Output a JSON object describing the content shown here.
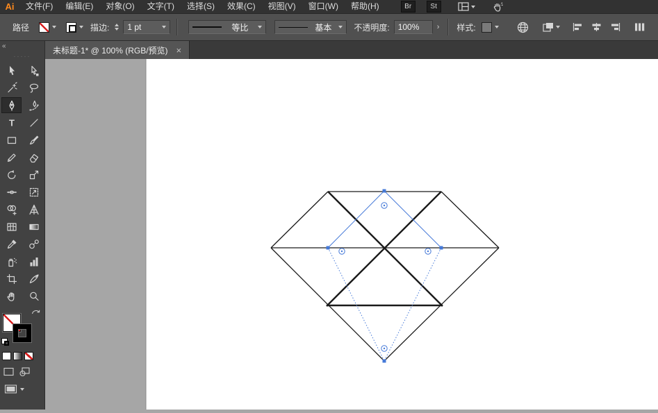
{
  "menubar": {
    "logo": "Ai",
    "items": [
      "文件(F)",
      "编辑(E)",
      "对象(O)",
      "文字(T)",
      "选择(S)",
      "效果(C)",
      "视图(V)",
      "窗口(W)",
      "帮助(H)"
    ],
    "bridge_badge": "Br",
    "stock_badge": "St"
  },
  "control_bar": {
    "context_label": "路径",
    "stroke_label": "描边:",
    "stroke_weight": "1 pt",
    "variable_width_profile": "等比",
    "brush_definition": "基本",
    "opacity_label": "不透明度:",
    "opacity_value": "100%",
    "opacity_flyout": "›",
    "style_label": "样式:"
  },
  "document_tab": {
    "title": "未标题-1* @ 100% (RGB/预览)",
    "close_label": "×"
  },
  "toolbar": {
    "selected_tool": "pen",
    "tools": [
      "selection",
      "direct-selection",
      "magic-wand",
      "lasso",
      "pen",
      "curvature",
      "type",
      "line-segment",
      "rectangle",
      "paintbrush",
      "pencil",
      "eraser",
      "rotate",
      "scale",
      "width",
      "free-transform",
      "shape-builder",
      "perspective-grid",
      "mesh",
      "gradient",
      "eyedropper",
      "blend",
      "symbol-sprayer",
      "column-graph",
      "artboard",
      "slice",
      "hand",
      "zoom"
    ],
    "fill_proxy": "none",
    "stroke_proxy": "black"
  },
  "canvas": {
    "artwork": "diamond gem line drawing with selected rotated-square path",
    "colors": {
      "selection_blue": "#4579d8",
      "artwork_stroke": "#1a1a1a",
      "artboard": "#ffffff",
      "pasteboard": "#a6a6a6"
    }
  }
}
